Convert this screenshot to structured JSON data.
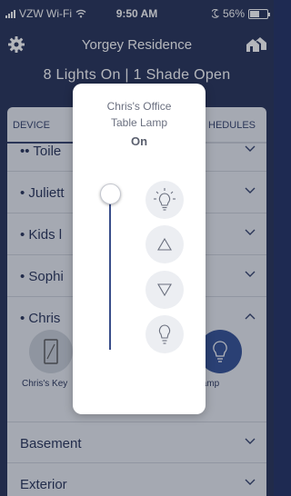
{
  "status_bar": {
    "carrier": "VZW Wi-Fi",
    "time": "9:50 AM",
    "battery_text": "56%",
    "battery_level": 0.56
  },
  "header": {
    "title": "Yorgey Residence",
    "icons": {
      "settings": "gear-icon",
      "home": "home-icon"
    }
  },
  "summary": "8 Lights On | 1 Shade Open",
  "tabs": {
    "left": "DEVICE",
    "right": "HEDULES"
  },
  "rooms": [
    {
      "label": "•• Toile"
    },
    {
      "label": "• Juliett"
    },
    {
      "label": "• Kids l"
    },
    {
      "label": "• Sophi"
    },
    {
      "label": "• Chris"
    },
    {
      "label": "Basement"
    },
    {
      "label": "Exterior"
    }
  ],
  "device_tiles": {
    "left_label": "Chris's Key",
    "right_label": "ble Lamp"
  },
  "modal": {
    "device_name_line1": "Chris's Office",
    "device_name_line2": "Table Lamp",
    "state": "On",
    "level": 1.0,
    "icons": [
      "light-on-icon",
      "raise-icon",
      "lower-icon",
      "light-off-icon"
    ]
  },
  "colors": {
    "background": "#1e2a52",
    "panel": "#e8ecf2",
    "accent": "#2b4a92",
    "slider": "#3a4e8a"
  }
}
